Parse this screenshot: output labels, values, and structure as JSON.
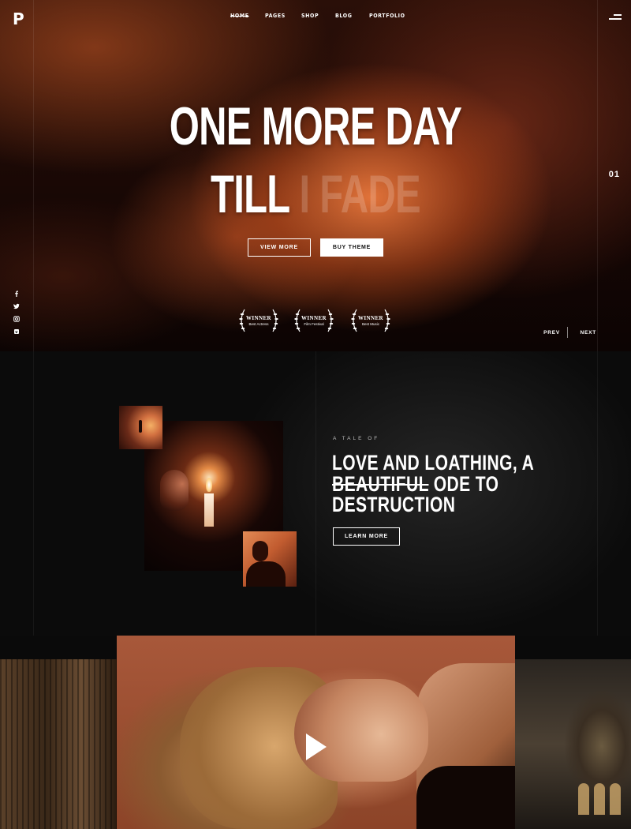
{
  "brand": {
    "logo": "P"
  },
  "nav": {
    "items": [
      {
        "label": "HOME"
      },
      {
        "label": "PAGES"
      },
      {
        "label": "SHOP"
      },
      {
        "label": "BLOG"
      },
      {
        "label": "PORTFOLIO"
      }
    ],
    "menu_icon": "hamburger-icon"
  },
  "hero": {
    "title_line1": "ONE MORE DAY",
    "title_line2_solid": "TILL",
    "title_line2_faded": " I FADE",
    "view_more_label": "VIEW MORE",
    "buy_theme_label": "BUY THEME",
    "awards": [
      {
        "title": "WINNER",
        "subtitle": "Best Actress"
      },
      {
        "title": "WINNER",
        "subtitle": "Film Festival"
      },
      {
        "title": "WINNER",
        "subtitle": "Best Music"
      }
    ],
    "slide_number": "01",
    "prev_label": "PREV",
    "next_label": "NEXT",
    "social_icons": [
      "facebook-icon",
      "twitter-icon",
      "instagram-icon",
      "vimeo-icon"
    ]
  },
  "story": {
    "kicker": "A TALE OF",
    "title_line1": "LOVE AND LOATHING, A",
    "title_line2_strike": "BEAUTIFUL",
    "title_line2_rest": " ODE TO",
    "title_line3": "DESTRUCTION",
    "learn_more_label": "LEARN MORE"
  },
  "video": {
    "play_icon": "play-icon"
  }
}
